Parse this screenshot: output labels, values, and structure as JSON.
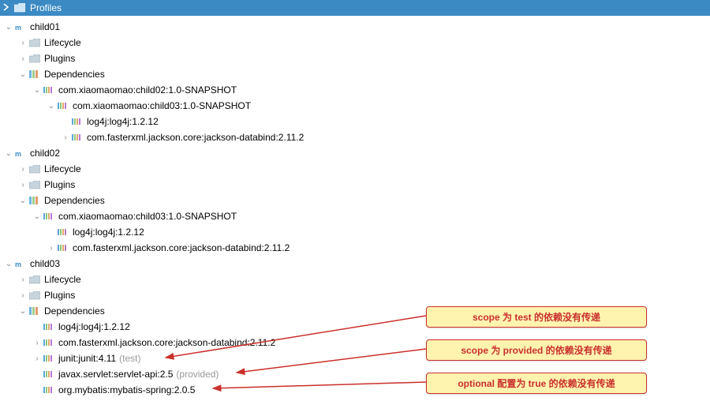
{
  "header": {
    "title": "Profiles"
  },
  "nodes": {
    "child01": "child01",
    "child02": "child02",
    "child03": "child03",
    "lifecycle": "Lifecycle",
    "plugins": "Plugins",
    "dependencies": "Dependencies",
    "dep_child02": "com.xiaomaomao:child02:1.0-SNAPSHOT",
    "dep_child03": "com.xiaomaomao:child03:1.0-SNAPSHOT",
    "dep_log4j": "log4j:log4j:1.2.12",
    "dep_jackson": "com.fasterxml.jackson.core:jackson-databind:2.11.2",
    "dep_junit": "junit:junit:4.11",
    "dep_servlet": "javax.servlet:servlet-api:2.5",
    "dep_mybatis": "org.mybatis:mybatis-spring:2.0.5",
    "scope_test": "(test)",
    "scope_provided": "(provided)"
  },
  "callouts": {
    "c1": "scope 为 test 的依赖没有传递",
    "c2": "scope 为 provided 的依赖没有传递",
    "c3": "optional 配置为 true 的依赖没有传递"
  },
  "colors": {
    "header_bg": "#3b8ac4",
    "callout_bg": "#fff3b0",
    "callout_border": "#c9302c",
    "arrow": "#c9302c"
  }
}
